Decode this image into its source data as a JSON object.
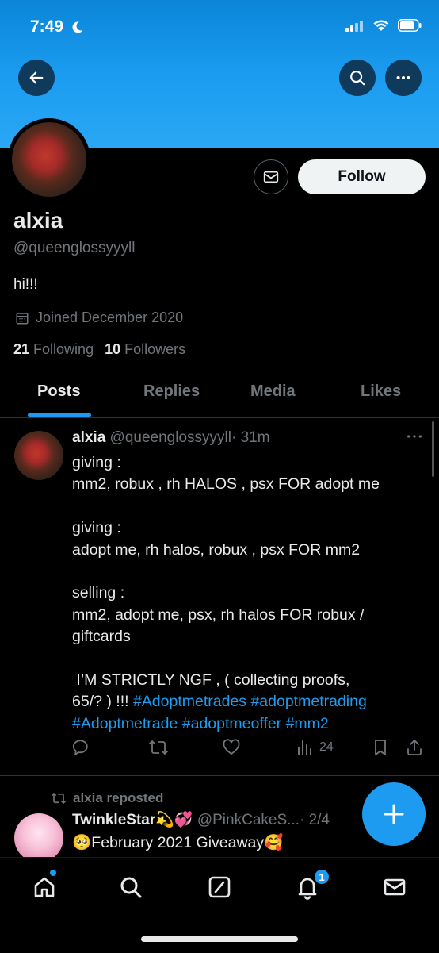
{
  "status_bar": {
    "time": "7:49"
  },
  "profile": {
    "name": "alxia",
    "handle": "@queenglossyyyll",
    "bio": "hi!!!",
    "joined": "Joined December 2020",
    "following_count": "21",
    "following_label": "Following",
    "followers_count": "10",
    "followers_label": "Followers",
    "follow_label": "Follow"
  },
  "tabs": [
    {
      "label": "Posts",
      "active": true
    },
    {
      "label": "Replies",
      "active": false
    },
    {
      "label": "Media",
      "active": false
    },
    {
      "label": "Likes",
      "active": false
    }
  ],
  "tweet": {
    "name": "alxia",
    "handle": "@queenglossyyyll",
    "time": "· 31m",
    "lines": {
      "l1": "giving :",
      "l2": "mm2, robux , rh HALOS , psx FOR adopt me",
      "l3": "giving :",
      "l4": "adopt me, rh halos, robux , psx FOR mm2",
      "l5": "selling :",
      "l6": "mm2, adopt me, psx, rh halos FOR robux /",
      "l7": "giftcards",
      "l8": " I’M STRICTLY NGF , ( collecting proofs,",
      "l9a": "65/? ) !!! ",
      "l9b": "#Adoptmetrades #adoptmetrading",
      "l10": "#Adoptmetrade #adoptmeoffer #mm2"
    },
    "views": "24"
  },
  "repost": {
    "label": "alxia reposted",
    "name": "TwinkleStar💫💞",
    "handle": "@PinkCakeS...",
    "time": "· 2/4",
    "text": "🥺February 2021 Giveaway🥰"
  },
  "nav": {
    "notifications_badge": "1"
  },
  "colors": {
    "accent": "#1d9bf0",
    "banner": "#1b9cf0"
  }
}
